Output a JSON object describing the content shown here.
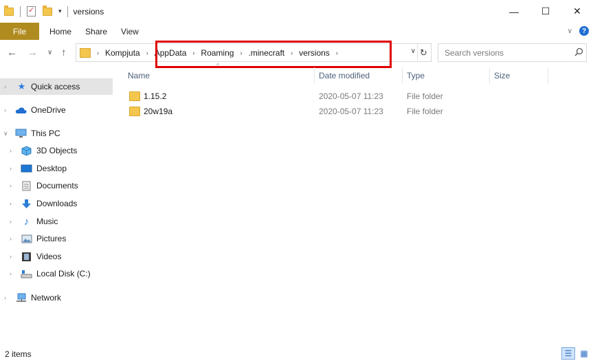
{
  "window": {
    "title": "versions",
    "controls": {
      "minimize": "—",
      "maximize": "☐",
      "close": "✕"
    }
  },
  "quick_access_toolbar": {
    "icons": [
      "folder-icon",
      "properties-icon",
      "new-folder-icon",
      "customize-dropdown-icon"
    ],
    "dropdown_glyph": "▾"
  },
  "ribbon": {
    "file_tab": "File",
    "tabs": [
      "Home",
      "Share",
      "View"
    ],
    "expand_glyph": "∨",
    "help_glyph": "?"
  },
  "navigation": {
    "back_glyph": "←",
    "forward_glyph": "→",
    "recent_glyph": "∨",
    "up_glyph": "↑"
  },
  "address_bar": {
    "breadcrumbs": [
      "Kompjuta",
      "AppData",
      "Roaming",
      ".minecraft",
      "versions"
    ],
    "separator_glyph": "›",
    "dropdown_glyph": "∨",
    "refresh_glyph": "↻"
  },
  "highlight": {
    "color": "#e00000",
    "target": "AppData › Roaming › .minecraft › versions"
  },
  "search": {
    "placeholder": "Search versions",
    "icon": "magnifier-icon"
  },
  "sidebar": {
    "expand_glyph": "›",
    "expanded_glyph": "∨",
    "items": [
      {
        "label": "Quick access",
        "icon": "star-icon",
        "selected": true
      },
      {
        "label": "OneDrive",
        "icon": "cloud-icon"
      },
      {
        "label": "This PC",
        "icon": "computer-icon",
        "expanded": true
      },
      {
        "label": "3D Objects",
        "icon": "cube-icon"
      },
      {
        "label": "Desktop",
        "icon": "desktop-icon"
      },
      {
        "label": "Documents",
        "icon": "document-icon"
      },
      {
        "label": "Downloads",
        "icon": "download-icon"
      },
      {
        "label": "Music",
        "icon": "music-icon"
      },
      {
        "label": "Pictures",
        "icon": "pictures-icon"
      },
      {
        "label": "Videos",
        "icon": "video-icon"
      },
      {
        "label": "Local Disk (C:)",
        "icon": "drive-icon"
      },
      {
        "label": "Network",
        "icon": "network-icon"
      }
    ]
  },
  "file_list": {
    "columns": [
      "Name",
      "Date modified",
      "Type",
      "Size"
    ],
    "sort_glyph": "^",
    "rows": [
      {
        "name": "1.15.2",
        "date_modified": "2020-05-07 11:23",
        "type": "File folder",
        "size": ""
      },
      {
        "name": "20w19a",
        "date_modified": "2020-05-07 11:23",
        "type": "File folder",
        "size": ""
      }
    ]
  },
  "status_bar": {
    "item_count": "2 items",
    "details_view_glyph": "☰",
    "large_icons_glyph": "▦"
  },
  "colors": {
    "file_tab": "#b08b1f",
    "folder": "#f3c64e",
    "column_header_text": "#4c607a",
    "selected_nav": "#e4e4e4",
    "highlight_box": "#e00000"
  }
}
